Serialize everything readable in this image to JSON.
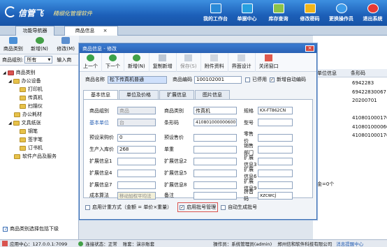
{
  "app": {
    "logo": "信管飞",
    "subtitle": "精细化管理软件"
  },
  "topnav": [
    {
      "label": "我的工作台",
      "icon": "desktop-icon",
      "color": "#2a8ad8"
    },
    {
      "label": "单据中心",
      "icon": "document-icon",
      "color": "#27a0e0"
    },
    {
      "label": "库存查询",
      "icon": "search-icon",
      "color": "#8bc34a"
    },
    {
      "label": "修改密码",
      "icon": "lock-icon",
      "color": "#f0b51a"
    },
    {
      "label": "更换操作员",
      "icon": "user-icon",
      "color": "#3d9be9"
    },
    {
      "label": "退出系统",
      "icon": "power-icon",
      "color": "#e53935"
    }
  ],
  "tabs": [
    {
      "label": "功能导航器"
    },
    {
      "label": "商品信息",
      "close": "×"
    }
  ],
  "left_toolbar": [
    {
      "label": "商品类别",
      "icon": "grid-icon"
    },
    {
      "label": "新增(N)",
      "icon": "plus-icon"
    },
    {
      "label": "修改(M)",
      "icon": "edit-icon"
    }
  ],
  "filter": {
    "label": "商品组别:",
    "value": "所有",
    "arrow": "▼",
    "input_label": "输入商"
  },
  "tree": [
    {
      "label": "商品类别",
      "level": 0
    },
    {
      "label": "办公设备",
      "level": 1
    },
    {
      "label": "打印机",
      "level": 2
    },
    {
      "label": "传真机",
      "level": 2
    },
    {
      "label": "扫描仪",
      "level": 2
    },
    {
      "label": "办公耗材",
      "level": 1
    },
    {
      "label": "文具纸张",
      "level": 1
    },
    {
      "label": "钢笔",
      "level": 2
    },
    {
      "label": "签字笔",
      "level": 2
    },
    {
      "label": "订书机",
      "level": 2
    },
    {
      "label": "软件产品及服务",
      "level": 1
    }
  ],
  "left_bottom": "商品类别选择包括下级",
  "right_table": {
    "headers": [
      "单位信息",
      "条形码"
    ],
    "rows": [
      "6942283",
      "69422830067",
      "20200701",
      "",
      "410801000170",
      "410801000060",
      "410801000170"
    ],
    "note": "金=0个"
  },
  "dialog": {
    "title": "商品信息 - 修改",
    "close": "×",
    "toolbar": [
      {
        "label": "上一个",
        "icon": "arrow-left-icon"
      },
      {
        "label": "下一个",
        "icon": "arrow-right-icon"
      },
      {
        "label": "新增(N)",
        "icon": "plus-icon"
      },
      {
        "label": "复制新增",
        "icon": "copy-icon"
      },
      {
        "label": "保存(S)",
        "icon": "save-icon"
      },
      {
        "label": "附件资料",
        "icon": "attachment-icon"
      },
      {
        "label": "界面设计",
        "icon": "layout-icon"
      },
      {
        "label": "关闭窗口",
        "icon": "close-window-icon"
      }
    ],
    "name_label": "商品名称",
    "name_value": "松下传真机普通",
    "code_label": "商品编码",
    "code_value": "100102001",
    "disabled_label": "已停用",
    "auto_code_label": "新增自动编码",
    "tabs": [
      "基本信息",
      "单位及价格",
      "扩展信息",
      "图片信息"
    ],
    "fields": {
      "group_label": "商品组别",
      "group_value": "商品",
      "category_label": "商品类别",
      "category_value": "传真机",
      "spec_label": "规格",
      "spec_value": "KX-FT862CN",
      "unit_label": "基本单位",
      "unit_value": "台",
      "barcode_label": "条形码",
      "barcode_value": "4108010000006001",
      "model_label": "型号",
      "preset_buy_label": "预设采购价",
      "preset_buy_value": "0",
      "preset_sale_label": "预设售价",
      "retail_label": "零售价",
      "origin_label": "生产入库价",
      "origin_value": "268",
      "weight_label": "单重",
      "dept_label": "销售部门",
      "ext1": "扩展信息1",
      "ext2": "扩展信息2",
      "ext3": "扩展信息3",
      "ext4": "扩展信息4",
      "ext5": "扩展信息5",
      "ext6": "扩展信息6",
      "ext7": "扩展信息7",
      "ext8": "扩展信息8",
      "ext9": "扩展信息9",
      "cost_label": "成本算法",
      "cost_value": "移动加权平均法",
      "remark_label": "备注",
      "pinyin_label": "拼音码",
      "pinyin_value": "xzcwcj"
    },
    "footer": {
      "measure": "启用计重方式（金额 = 单价×重量）",
      "batch": "启用批号管理",
      "auto_batch": "自动生成批号"
    }
  },
  "status": {
    "app_server": "应用中心：127.0.0.1:7099",
    "conn": "连接状态：正常",
    "reserve": "账套：演示账套",
    "operator": "操作员：系统管理员(admin)",
    "company": "郑州信和软件科技有限公司",
    "msg": "消息提醒中心"
  }
}
